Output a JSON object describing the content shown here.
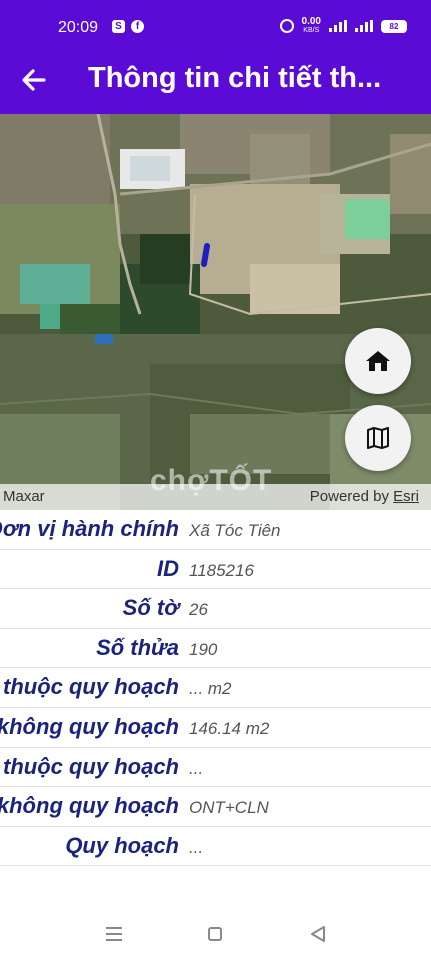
{
  "status_bar": {
    "time": "20:09",
    "net_speed_value": "0.00",
    "net_speed_unit": "KB/S",
    "battery": "82",
    "notification_icons": [
      "s-icon",
      "facebook-icon"
    ]
  },
  "app_bar": {
    "title": "Thông tin chi tiết th...",
    "back_icon": "arrow-left-icon",
    "color": "#5b0bd6"
  },
  "map": {
    "attribution_left": "Maxar",
    "attribution_right_prefix": "Powered by ",
    "attribution_right_link": "Esri",
    "watermark": "chợTỐT",
    "buttons": [
      "home-icon",
      "map-icon"
    ]
  },
  "details": [
    {
      "label": "Đơn vị hành chính",
      "value": "Xã Tóc Tiên"
    },
    {
      "label": "ID",
      "value": "1185216"
    },
    {
      "label": "Số tờ",
      "value": "26"
    },
    {
      "label": "Số thửa",
      "value": "190"
    },
    {
      "label": "Diện tích thuộc quy hoạch",
      "value": "... m2"
    },
    {
      "label": "Diện tích không quy hoạch",
      "value": "146.14 m2"
    },
    {
      "label": "Loại đất thuộc quy hoạch",
      "value": "..."
    },
    {
      "label": "Loại đất không quy hoạch",
      "value": "ONT+CLN"
    },
    {
      "label": "Quy hoạch",
      "value": "..."
    }
  ],
  "nav_bar": {
    "icons": [
      "menu-icon",
      "home-square-icon",
      "back-triangle-icon"
    ]
  }
}
